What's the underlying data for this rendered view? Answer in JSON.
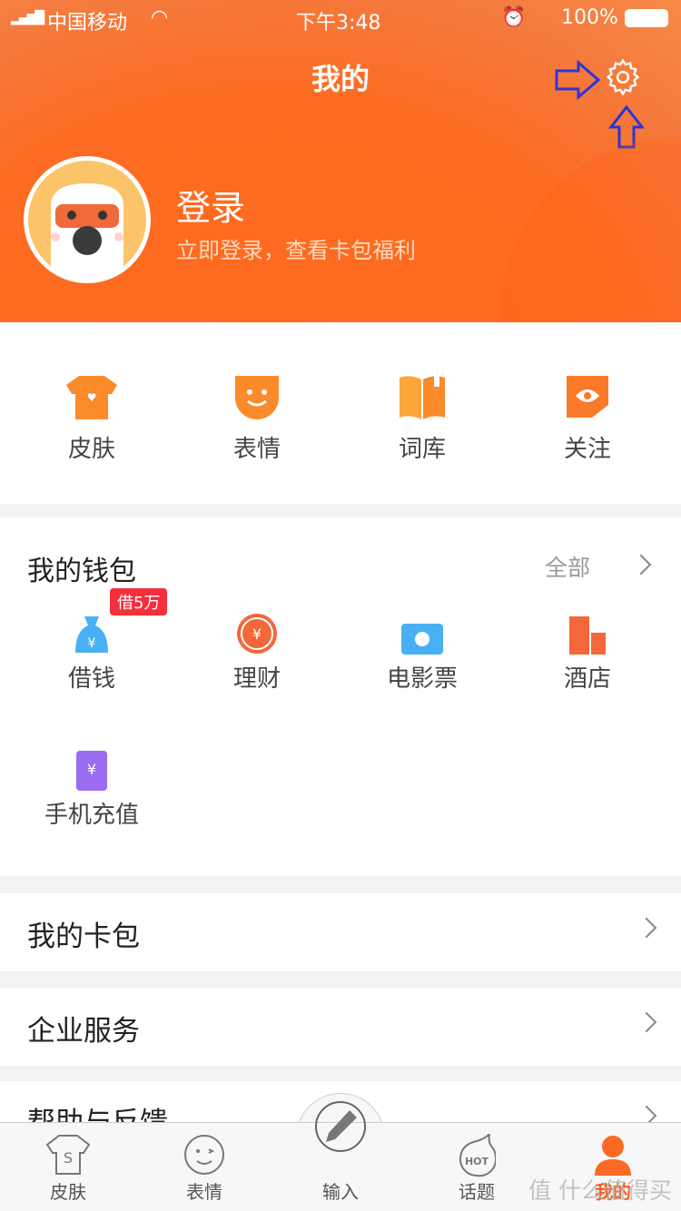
{
  "status": {
    "carrier": "中国移动",
    "time": "下午3:48",
    "battery": "100%"
  },
  "header": {
    "title": "我的",
    "login": "登录",
    "login_sub": "立即登录，查看卡包福利"
  },
  "quick": [
    {
      "label": "皮肤",
      "icon": "tshirt-icon"
    },
    {
      "label": "表情",
      "icon": "smile-icon"
    },
    {
      "label": "词库",
      "icon": "book-icon"
    },
    {
      "label": "关注",
      "icon": "eye-icon"
    }
  ],
  "wallet": {
    "title": "我的钱包",
    "all": "全部",
    "badge": "借5万",
    "items": [
      {
        "label": "借钱",
        "icon": "money-bag-icon"
      },
      {
        "label": "理财",
        "icon": "coin-icon"
      },
      {
        "label": "电影票",
        "icon": "film-ticket-icon"
      },
      {
        "label": "酒店",
        "icon": "hotel-icon"
      },
      {
        "label": "手机充值",
        "icon": "phone-recharge-icon"
      }
    ]
  },
  "rows": [
    "我的卡包",
    "企业服务",
    "帮助与反馈"
  ],
  "tabs": [
    {
      "label": "皮肤",
      "icon": "tshirt-icon"
    },
    {
      "label": "表情",
      "icon": "wink-icon"
    },
    {
      "label": "输入",
      "icon": "pencil-icon"
    },
    {
      "label": "话题",
      "icon": "hot-icon"
    },
    {
      "label": "我的",
      "icon": "user-icon"
    }
  ],
  "watermark": "值 什么值得买",
  "colors": {
    "accent": "#fd6a1f",
    "annotation": "#2b35d6"
  }
}
